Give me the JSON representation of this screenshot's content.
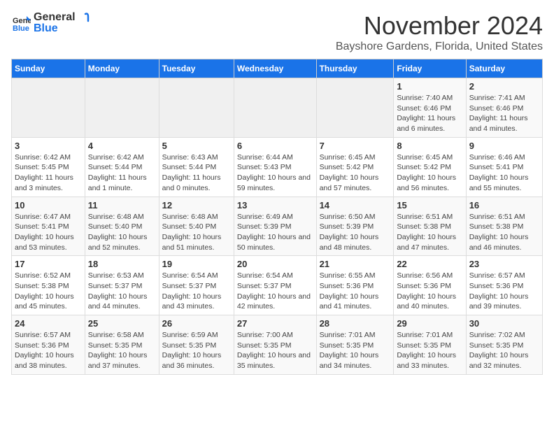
{
  "header": {
    "logo_general": "General",
    "logo_blue": "Blue",
    "month": "November 2024",
    "location": "Bayshore Gardens, Florida, United States"
  },
  "weekdays": [
    "Sunday",
    "Monday",
    "Tuesday",
    "Wednesday",
    "Thursday",
    "Friday",
    "Saturday"
  ],
  "weeks": [
    [
      {
        "day": "",
        "info": ""
      },
      {
        "day": "",
        "info": ""
      },
      {
        "day": "",
        "info": ""
      },
      {
        "day": "",
        "info": ""
      },
      {
        "day": "",
        "info": ""
      },
      {
        "day": "1",
        "info": "Sunrise: 7:40 AM\nSunset: 6:46 PM\nDaylight: 11 hours and 6 minutes."
      },
      {
        "day": "2",
        "info": "Sunrise: 7:41 AM\nSunset: 6:46 PM\nDaylight: 11 hours and 4 minutes."
      }
    ],
    [
      {
        "day": "3",
        "info": "Sunrise: 6:42 AM\nSunset: 5:45 PM\nDaylight: 11 hours and 3 minutes."
      },
      {
        "day": "4",
        "info": "Sunrise: 6:42 AM\nSunset: 5:44 PM\nDaylight: 11 hours and 1 minute."
      },
      {
        "day": "5",
        "info": "Sunrise: 6:43 AM\nSunset: 5:44 PM\nDaylight: 11 hours and 0 minutes."
      },
      {
        "day": "6",
        "info": "Sunrise: 6:44 AM\nSunset: 5:43 PM\nDaylight: 10 hours and 59 minutes."
      },
      {
        "day": "7",
        "info": "Sunrise: 6:45 AM\nSunset: 5:42 PM\nDaylight: 10 hours and 57 minutes."
      },
      {
        "day": "8",
        "info": "Sunrise: 6:45 AM\nSunset: 5:42 PM\nDaylight: 10 hours and 56 minutes."
      },
      {
        "day": "9",
        "info": "Sunrise: 6:46 AM\nSunset: 5:41 PM\nDaylight: 10 hours and 55 minutes."
      }
    ],
    [
      {
        "day": "10",
        "info": "Sunrise: 6:47 AM\nSunset: 5:41 PM\nDaylight: 10 hours and 53 minutes."
      },
      {
        "day": "11",
        "info": "Sunrise: 6:48 AM\nSunset: 5:40 PM\nDaylight: 10 hours and 52 minutes."
      },
      {
        "day": "12",
        "info": "Sunrise: 6:48 AM\nSunset: 5:40 PM\nDaylight: 10 hours and 51 minutes."
      },
      {
        "day": "13",
        "info": "Sunrise: 6:49 AM\nSunset: 5:39 PM\nDaylight: 10 hours and 50 minutes."
      },
      {
        "day": "14",
        "info": "Sunrise: 6:50 AM\nSunset: 5:39 PM\nDaylight: 10 hours and 48 minutes."
      },
      {
        "day": "15",
        "info": "Sunrise: 6:51 AM\nSunset: 5:38 PM\nDaylight: 10 hours and 47 minutes."
      },
      {
        "day": "16",
        "info": "Sunrise: 6:51 AM\nSunset: 5:38 PM\nDaylight: 10 hours and 46 minutes."
      }
    ],
    [
      {
        "day": "17",
        "info": "Sunrise: 6:52 AM\nSunset: 5:38 PM\nDaylight: 10 hours and 45 minutes."
      },
      {
        "day": "18",
        "info": "Sunrise: 6:53 AM\nSunset: 5:37 PM\nDaylight: 10 hours and 44 minutes."
      },
      {
        "day": "19",
        "info": "Sunrise: 6:54 AM\nSunset: 5:37 PM\nDaylight: 10 hours and 43 minutes."
      },
      {
        "day": "20",
        "info": "Sunrise: 6:54 AM\nSunset: 5:37 PM\nDaylight: 10 hours and 42 minutes."
      },
      {
        "day": "21",
        "info": "Sunrise: 6:55 AM\nSunset: 5:36 PM\nDaylight: 10 hours and 41 minutes."
      },
      {
        "day": "22",
        "info": "Sunrise: 6:56 AM\nSunset: 5:36 PM\nDaylight: 10 hours and 40 minutes."
      },
      {
        "day": "23",
        "info": "Sunrise: 6:57 AM\nSunset: 5:36 PM\nDaylight: 10 hours and 39 minutes."
      }
    ],
    [
      {
        "day": "24",
        "info": "Sunrise: 6:57 AM\nSunset: 5:36 PM\nDaylight: 10 hours and 38 minutes."
      },
      {
        "day": "25",
        "info": "Sunrise: 6:58 AM\nSunset: 5:35 PM\nDaylight: 10 hours and 37 minutes."
      },
      {
        "day": "26",
        "info": "Sunrise: 6:59 AM\nSunset: 5:35 PM\nDaylight: 10 hours and 36 minutes."
      },
      {
        "day": "27",
        "info": "Sunrise: 7:00 AM\nSunset: 5:35 PM\nDaylight: 10 hours and 35 minutes."
      },
      {
        "day": "28",
        "info": "Sunrise: 7:01 AM\nSunset: 5:35 PM\nDaylight: 10 hours and 34 minutes."
      },
      {
        "day": "29",
        "info": "Sunrise: 7:01 AM\nSunset: 5:35 PM\nDaylight: 10 hours and 33 minutes."
      },
      {
        "day": "30",
        "info": "Sunrise: 7:02 AM\nSunset: 5:35 PM\nDaylight: 10 hours and 32 minutes."
      }
    ]
  ]
}
